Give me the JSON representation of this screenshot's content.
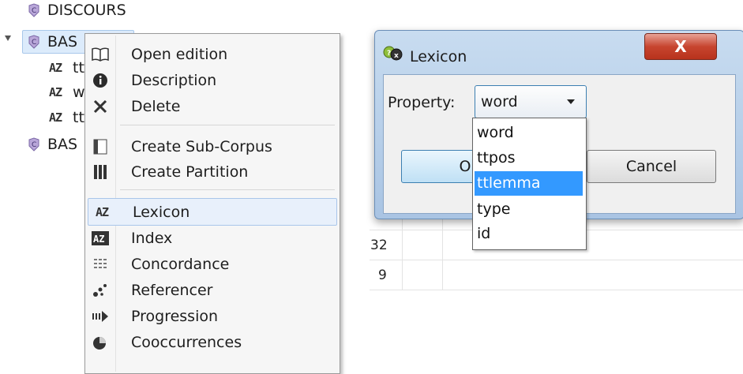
{
  "tree": {
    "items": [
      {
        "label": "DISCOURS"
      },
      {
        "label": "BAS"
      },
      {
        "label": "tt"
      },
      {
        "label": "w"
      },
      {
        "label": "tt"
      },
      {
        "label": "BAS"
      }
    ]
  },
  "context_menu": {
    "items": [
      {
        "label": "Open edition",
        "icon": "book-icon"
      },
      {
        "label": "Description",
        "icon": "info-icon"
      },
      {
        "label": "Delete",
        "icon": "delete-icon"
      },
      {
        "label": "Create Sub-Corpus",
        "icon": "subcorpus-icon"
      },
      {
        "label": "Create Partition",
        "icon": "partition-icon"
      },
      {
        "label": "Lexicon",
        "icon": "lexicon-icon"
      },
      {
        "label": "Index",
        "icon": "index-icon"
      },
      {
        "label": "Concordance",
        "icon": "concordance-icon"
      },
      {
        "label": "Referencer",
        "icon": "referencer-icon"
      },
      {
        "label": "Progression",
        "icon": "progression-icon"
      },
      {
        "label": "Cooccurrences",
        "icon": "cooccurrences-icon"
      }
    ],
    "highlighted": "Lexicon"
  },
  "background_table": {
    "values": [
      "32",
      "9"
    ]
  },
  "dialog": {
    "title": "Lexicon",
    "close_label": "X",
    "property_label": "Property:",
    "property_value": "word",
    "ok_label": "O",
    "cancel_label": "Cancel",
    "options": [
      "word",
      "ttpos",
      "ttlemma",
      "type",
      "id"
    ],
    "highlighted_option": "ttlemma"
  },
  "az_glyph": "AZ",
  "colors": {
    "selection_blue": "#3399ff",
    "menu_highlight": "#e8f0fb",
    "close_red": "#c7452f"
  }
}
